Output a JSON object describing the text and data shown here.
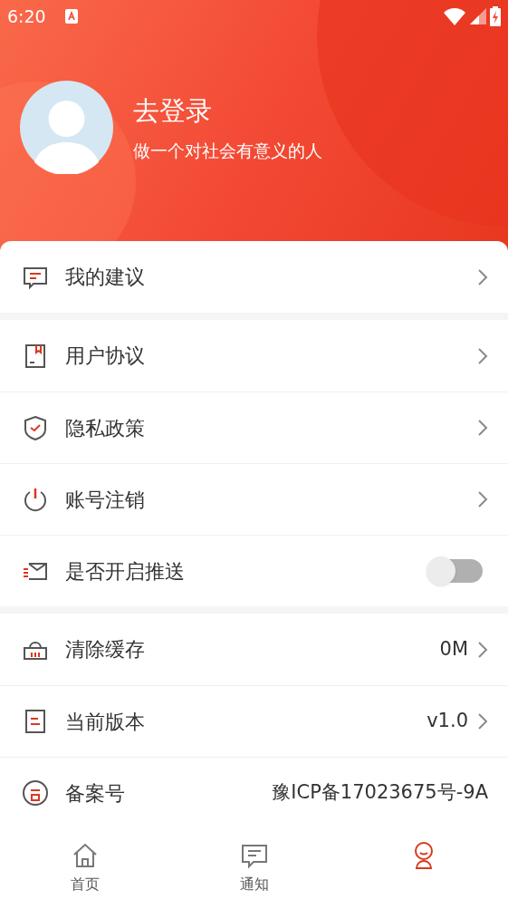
{
  "status_bar": {
    "time": "6:20"
  },
  "profile": {
    "name": "去登录",
    "motto": "做一个对社会有意义的人"
  },
  "groups": [
    {
      "items": [
        {
          "kind": "link",
          "label": "我的建议"
        }
      ]
    },
    {
      "items": [
        {
          "kind": "link",
          "label": "用户协议"
        },
        {
          "kind": "link",
          "label": "隐私政策"
        },
        {
          "kind": "link",
          "label": "账号注销"
        },
        {
          "kind": "toggle",
          "label": "是否开启推送",
          "on": false
        }
      ]
    },
    {
      "items": [
        {
          "kind": "value",
          "label": "清除缓存",
          "value": "0M"
        },
        {
          "kind": "value",
          "label": "当前版本",
          "value": "v1.0"
        },
        {
          "kind": "info",
          "label": "备案号",
          "value": "豫ICP备17023675号-9A"
        }
      ]
    }
  ],
  "bottom_nav": [
    {
      "label": "首页",
      "selected": false
    },
    {
      "label": "通知",
      "selected": false
    },
    {
      "selected": true
    }
  ]
}
